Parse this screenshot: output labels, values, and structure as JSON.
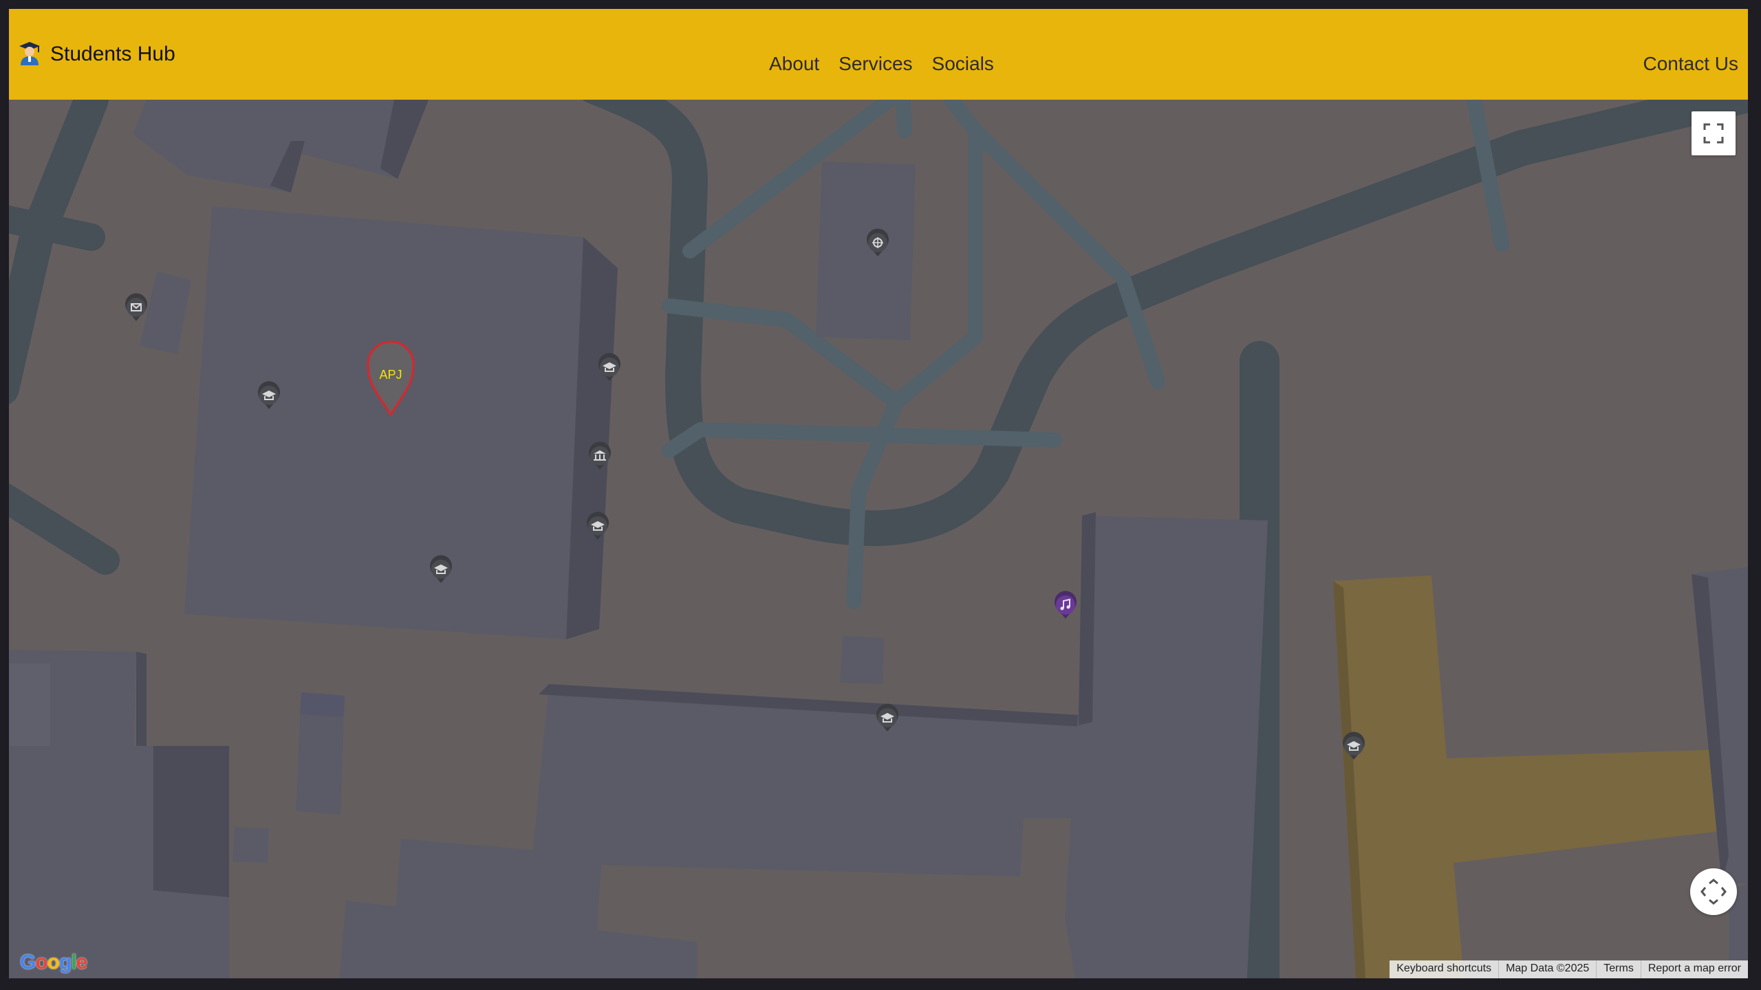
{
  "navbar": {
    "brand": "Students Hub",
    "brand_icon": "student-icon",
    "links": [
      "About",
      "Services",
      "Socials"
    ],
    "contact": "Contact Us"
  },
  "map": {
    "marker_label": "APJ",
    "logo": "Google",
    "attribution": {
      "shortcuts": "Keyboard shortcuts",
      "data": "Map Data ©2025",
      "terms": "Terms",
      "report": "Report a map error"
    },
    "poi_icons": [
      "mail-icon",
      "school-icon",
      "museum-icon",
      "temple-icon",
      "music-icon"
    ]
  },
  "colors": {
    "navbar": "#e8b50c",
    "ground": "#655e5f",
    "building": "#5a5b66",
    "road": "#465056",
    "path": "#52616a",
    "highlight_building": "#7a6841",
    "marker": "#d9252d"
  }
}
